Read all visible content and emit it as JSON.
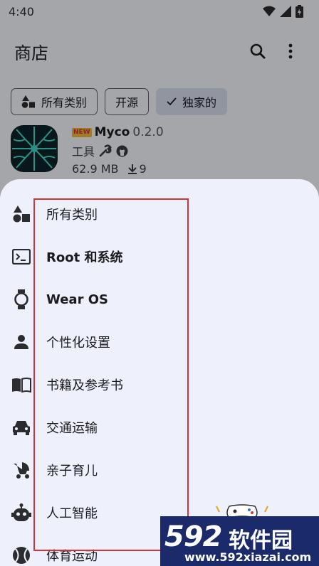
{
  "status_bar": {
    "time": "4:40"
  },
  "app_bar": {
    "title": "商店",
    "search_icon": "search-icon",
    "more_icon": "more-vert-icon"
  },
  "filters": [
    {
      "label": "所有类别",
      "icon": "category-shapes-icon",
      "selected": false
    },
    {
      "label": "开源",
      "selected": false
    },
    {
      "label": "独家的",
      "icon": "check-icon",
      "selected": true
    }
  ],
  "app_card": {
    "badge": "NEW",
    "name": "Myco",
    "version": "0.2.0",
    "category": "工具",
    "size": "62.9 MB",
    "downloads": "9"
  },
  "categories": [
    {
      "label": "所有类别",
      "icon": "category-shapes-icon",
      "bold": false
    },
    {
      "label": "Root 和系统",
      "icon": "terminal-icon",
      "bold": true
    },
    {
      "label": "Wear OS",
      "icon": "watch-icon",
      "bold": true
    },
    {
      "label": "个性化设置",
      "icon": "person-icon",
      "bold": false
    },
    {
      "label": "书籍及参考书",
      "icon": "book-icon",
      "bold": false
    },
    {
      "label": "交通运输",
      "icon": "car-icon",
      "bold": false
    },
    {
      "label": "亲子育儿",
      "icon": "stroller-icon",
      "bold": false
    },
    {
      "label": "人工智能",
      "icon": "robot-icon",
      "bold": false
    },
    {
      "label": "体育运动",
      "icon": "ball-icon",
      "bold": false
    }
  ],
  "watermark": {
    "number": "592",
    "name": "软件园",
    "url": "www.592xiazai.com"
  },
  "colors": {
    "highlight": "#d3333b",
    "sheet": "#eef0fb",
    "chip_selected": "#d5dcea"
  }
}
